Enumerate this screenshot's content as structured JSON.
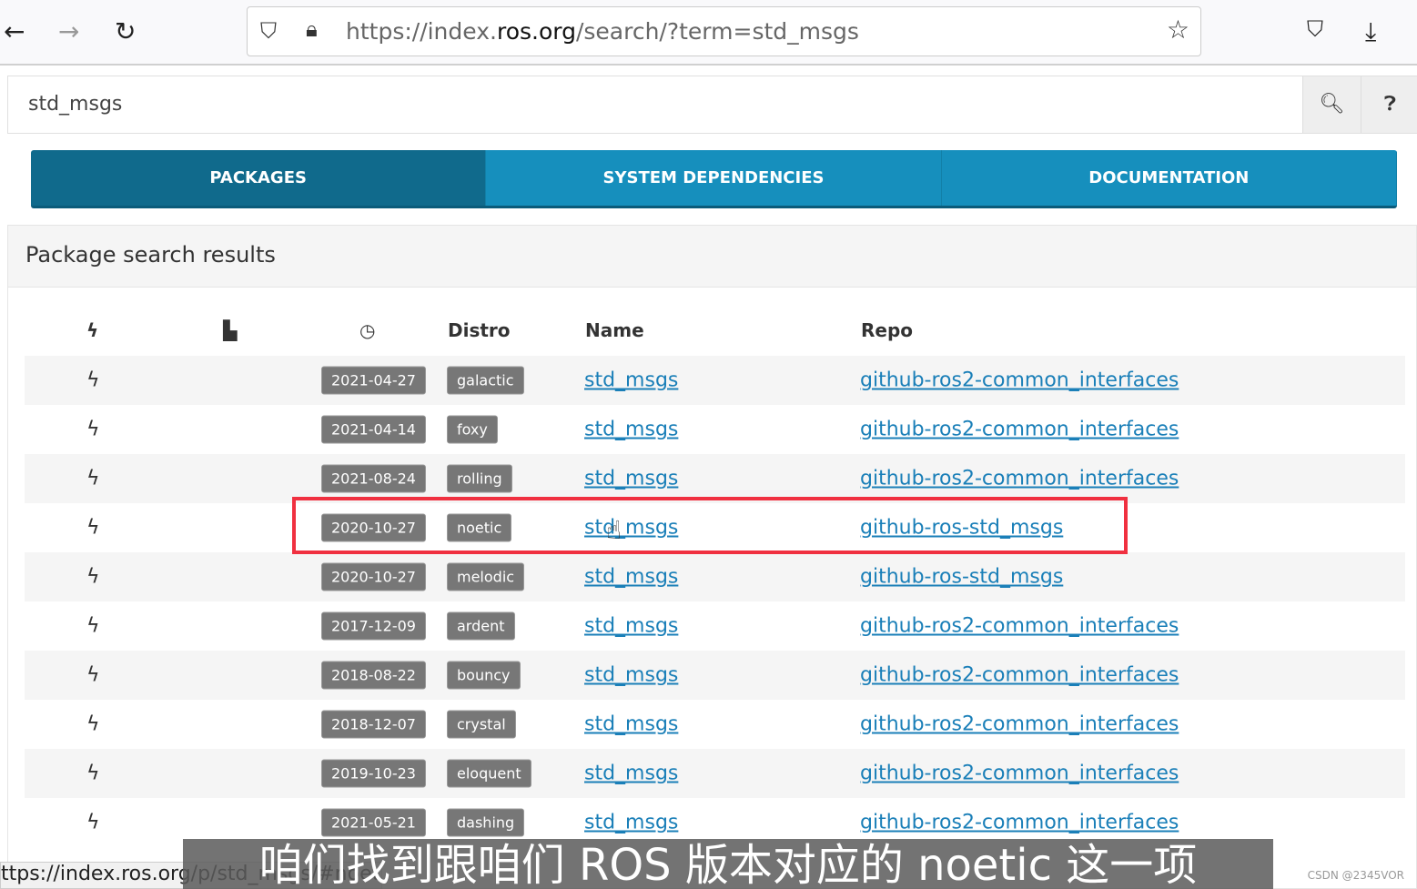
{
  "browser": {
    "url_prefix": "https://index.",
    "url_domain": "ros.org",
    "url_suffix": "/search/?term=std_msgs",
    "status_url": "ttps://index.ros.org/p/std_msgs/#noetic"
  },
  "search": {
    "value": "std_msgs"
  },
  "tabs": [
    {
      "label": "PACKAGES",
      "active": true
    },
    {
      "label": "SYSTEM DEPENDENCIES"
    },
    {
      "label": "DOCUMENTATION"
    }
  ],
  "panel": {
    "title": "Package search results"
  },
  "columns": {
    "distro": "Distro",
    "name": "Name",
    "repo": "Repo"
  },
  "rows": [
    {
      "date": "2021-04-27",
      "distro": "galactic",
      "name": "std_msgs",
      "repo": "github-ros2-common_interfaces"
    },
    {
      "date": "2021-04-14",
      "distro": "foxy",
      "name": "std_msgs",
      "repo": "github-ros2-common_interfaces"
    },
    {
      "date": "2021-08-24",
      "distro": "rolling",
      "name": "std_msgs",
      "repo": "github-ros2-common_interfaces"
    },
    {
      "date": "2020-10-27",
      "distro": "noetic",
      "name": "std_msgs",
      "repo": "github-ros-std_msgs"
    },
    {
      "date": "2020-10-27",
      "distro": "melodic",
      "name": "std_msgs",
      "repo": "github-ros-std_msgs"
    },
    {
      "date": "2017-12-09",
      "distro": "ardent",
      "name": "std_msgs",
      "repo": "github-ros2-common_interfaces"
    },
    {
      "date": "2018-08-22",
      "distro": "bouncy",
      "name": "std_msgs",
      "repo": "github-ros2-common_interfaces"
    },
    {
      "date": "2018-12-07",
      "distro": "crystal",
      "name": "std_msgs",
      "repo": "github-ros2-common_interfaces"
    },
    {
      "date": "2019-10-23",
      "distro": "eloquent",
      "name": "std_msgs",
      "repo": "github-ros2-common_interfaces"
    },
    {
      "date": "2021-05-21",
      "distro": "dashing",
      "name": "std_msgs",
      "repo": "github-ros2-common_interfaces"
    }
  ],
  "subtitle": "咱们找到跟咱们 ROS 版本对应的 noetic 这一项",
  "watermark": "CSDN @2345VOR",
  "colors": {
    "tab": "#168fbd",
    "tab_active": "#106a8c",
    "highlight": "#f03040",
    "link": "#1a7fb8"
  }
}
